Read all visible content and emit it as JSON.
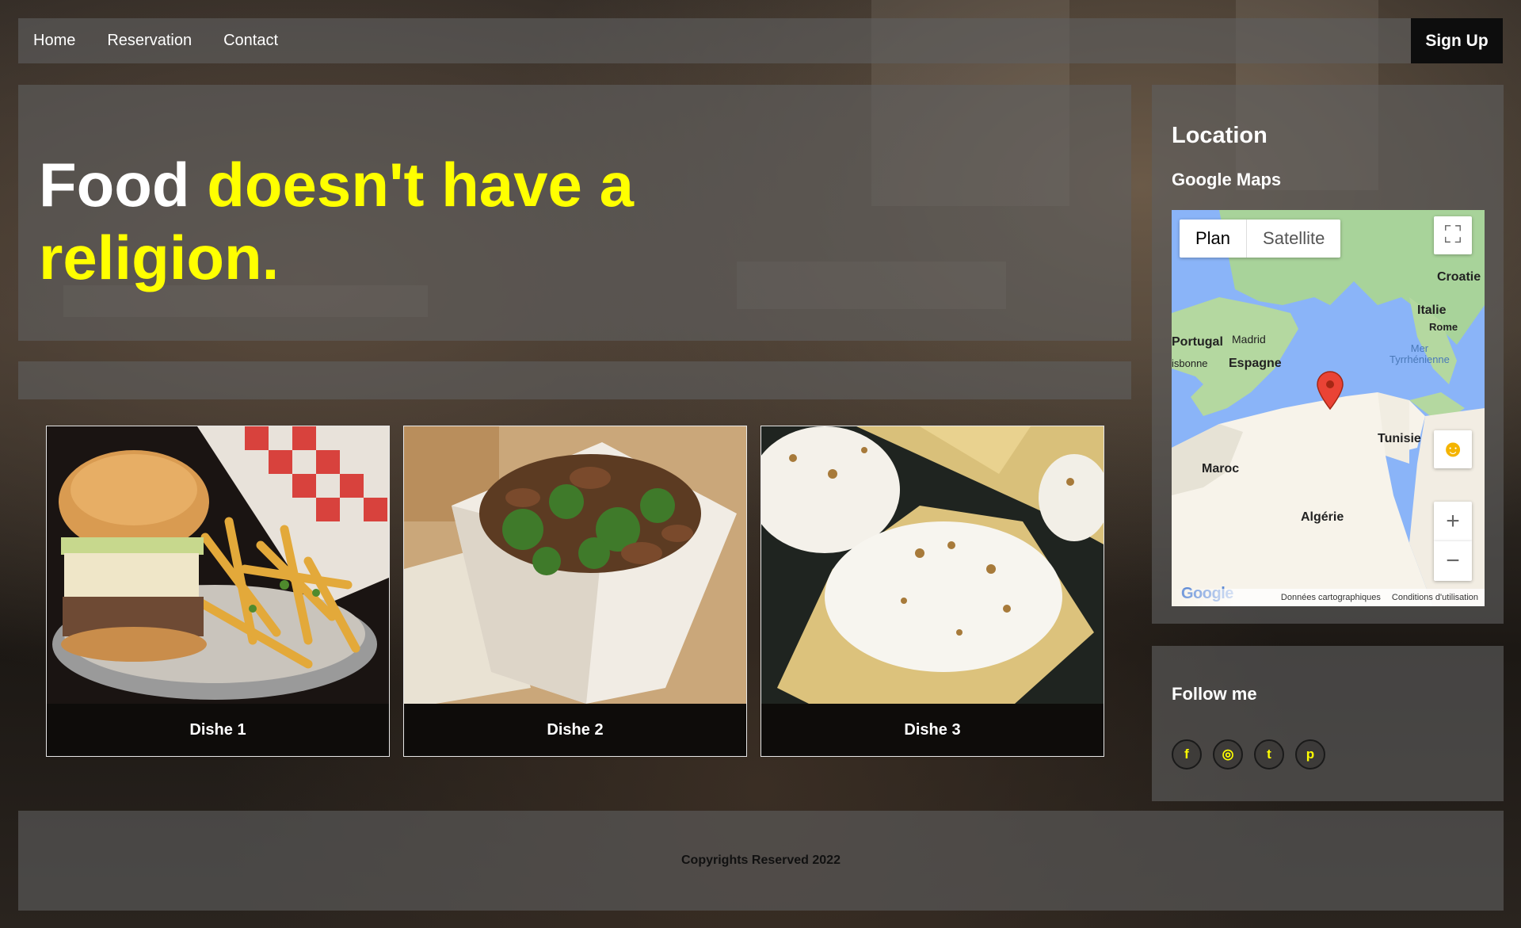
{
  "nav": {
    "links": [
      "Home",
      "Reservation",
      "Contact"
    ],
    "signup": "Sign Up"
  },
  "hero": {
    "title_white": "Food",
    "title_yellow": "doesn't have a religion."
  },
  "dishes": [
    {
      "label": "Dishe 1",
      "image": "burger with fries"
    },
    {
      "label": "Dishe 2",
      "image": "beef and broccoli box"
    },
    {
      "label": "Dishe 3",
      "image": "pancake with cream"
    }
  ],
  "location": {
    "title": "Location",
    "subtitle": "Google Maps",
    "map": {
      "tab_plan": "Plan",
      "tab_satellite": "Satellite",
      "labels": {
        "croatie": "Croatie",
        "italie": "Italie",
        "rome": "Rome",
        "portugal": "Portugal",
        "madrid": "Madrid",
        "espagne": "Espagne",
        "lisbonne": "isbonne",
        "mer": "Mer\nTyrrhénienne",
        "tunisie": "Tunisie",
        "maroc": "Maroc",
        "algerie": "Algérie"
      },
      "logo": "Google",
      "data_credit": "Données cartographiques",
      "terms": "Conditions d'utilisation"
    }
  },
  "follow": {
    "title": "Follow me",
    "icons": [
      "facebook-icon",
      "instagram-icon",
      "twitter-icon",
      "pinterest-icon"
    ],
    "glyphs": [
      "f",
      "◎",
      "t",
      "p"
    ]
  },
  "footer": {
    "text": "Copyrights Reserved 2022"
  },
  "colors": {
    "accent": "#ffff00",
    "panel": "rgba(95,95,95,0.62)",
    "signup_bg": "#0d0d0d"
  }
}
